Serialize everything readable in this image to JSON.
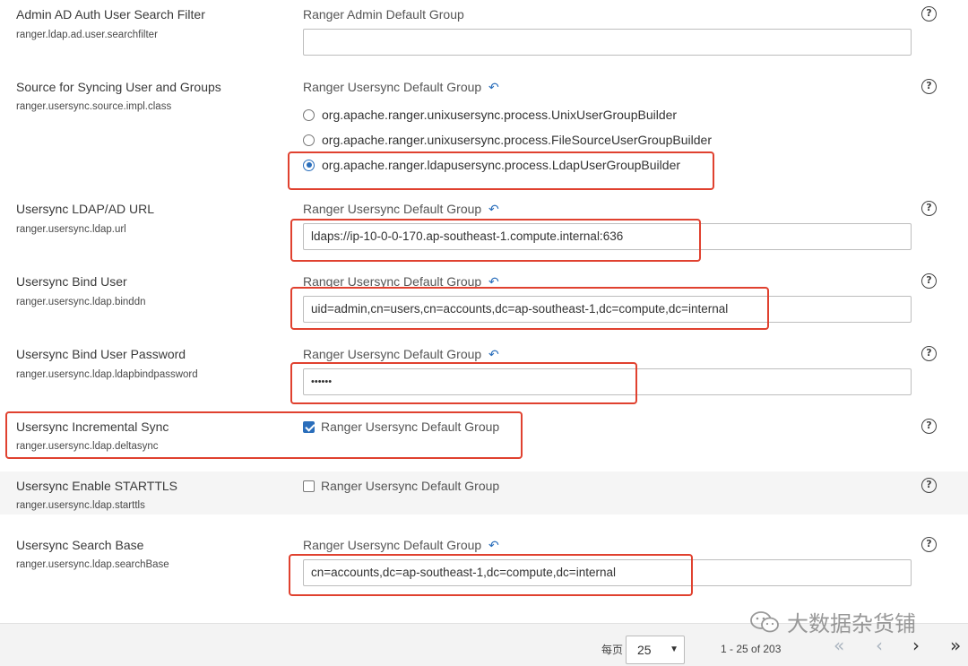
{
  "rows": [
    {
      "title": "Admin AD Auth User Search Filter",
      "key": "ranger.ldap.ad.user.searchfilter",
      "group": "Ranger Admin Default Group",
      "value": ""
    },
    {
      "title": "Source for Syncing User and Groups",
      "key": "ranger.usersync.source.impl.class",
      "group": "Ranger Usersync Default Group",
      "options": [
        "org.apache.ranger.unixusersync.process.UnixUserGroupBuilder",
        "org.apache.ranger.unixusersync.process.FileSourceUserGroupBuilder",
        "org.apache.ranger.ldapusersync.process.LdapUserGroupBuilder"
      ],
      "selected": "org.apache.ranger.ldapusersync.process.LdapUserGroupBuilder"
    },
    {
      "title": "Usersync LDAP/AD URL",
      "key": "ranger.usersync.ldap.url",
      "group": "Ranger Usersync Default Group",
      "value": "ldaps://ip-10-0-0-170.ap-southeast-1.compute.internal:636"
    },
    {
      "title": "Usersync Bind User",
      "key": "ranger.usersync.ldap.binddn",
      "group": "Ranger Usersync Default Group",
      "value": "uid=admin,cn=users,cn=accounts,dc=ap-southeast-1,dc=compute,dc=internal"
    },
    {
      "title": "Usersync Bind User Password",
      "key": "ranger.usersync.ldap.ldapbindpassword",
      "group": "Ranger Usersync Default Group",
      "value": "••••••"
    },
    {
      "title": "Usersync Incremental Sync",
      "key": "ranger.usersync.ldap.deltasync",
      "group": "Ranger Usersync Default Group",
      "checked": true
    },
    {
      "title": "Usersync Enable STARTTLS",
      "key": "ranger.usersync.ldap.starttls",
      "group": "Ranger Usersync Default Group",
      "checked": false
    },
    {
      "title": "Usersync Search Base",
      "key": "ranger.usersync.ldap.searchBase",
      "group": "Ranger Usersync Default Group",
      "value": "cn=accounts,dc=ap-southeast-1,dc=compute,dc=internal"
    }
  ],
  "icons": {
    "undo": "undo-arrow-icon",
    "help": "question-circle-icon",
    "help_glyph": "?",
    "undo_glyph": "↶"
  },
  "pagination": {
    "per_page_label": "每页",
    "per_page_value": "25",
    "range": "1 - 25 of 203",
    "first": "«",
    "prev": "‹",
    "next": "›",
    "last": "»"
  },
  "watermark": "大数据杂货铺",
  "colors": {
    "accent": "#2a6ebb",
    "highlight": "#e0412f"
  }
}
